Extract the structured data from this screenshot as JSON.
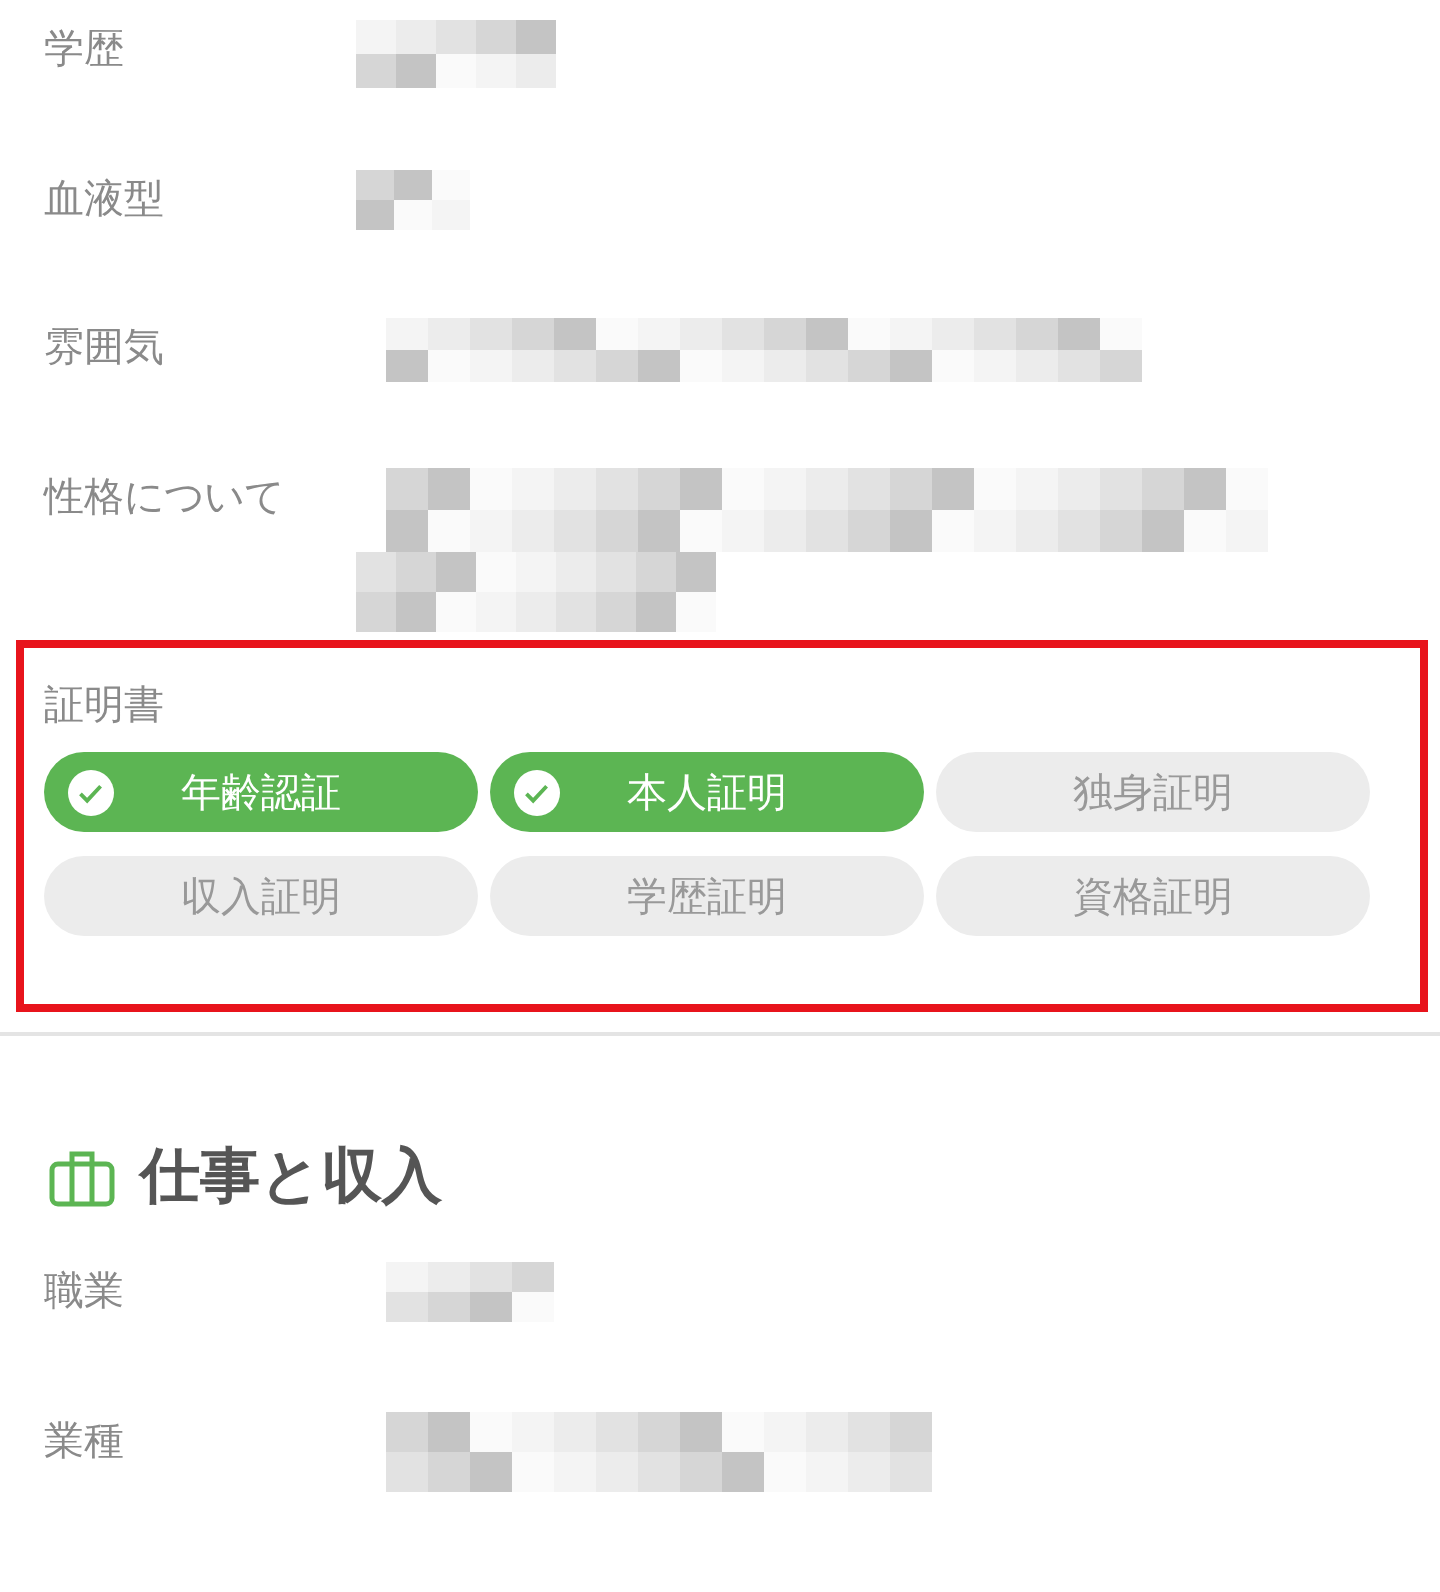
{
  "profile_rows": [
    {
      "label": "学歴",
      "value": {
        "kind": "mosaic"
      }
    },
    {
      "label": "血液型",
      "value": {
        "kind": "mosaic"
      }
    },
    {
      "label": "雰囲気",
      "value": {
        "kind": "mosaic"
      }
    },
    {
      "label": "性格について",
      "value": {
        "kind": "mosaic"
      }
    }
  ],
  "certificates": {
    "title": "証明書",
    "items": [
      {
        "label": "年齢認証",
        "verified": true
      },
      {
        "label": "本人証明",
        "verified": true
      },
      {
        "label": "独身証明",
        "verified": false
      },
      {
        "label": "収入証明",
        "verified": false
      },
      {
        "label": "学歴証明",
        "verified": false
      },
      {
        "label": "資格証明",
        "verified": false
      }
    ]
  },
  "work_section": {
    "title": "仕事と収入",
    "rows": [
      {
        "label": "職業",
        "value": {
          "kind": "mosaic"
        }
      },
      {
        "label": "業種",
        "value": {
          "kind": "mosaic"
        }
      }
    ]
  }
}
